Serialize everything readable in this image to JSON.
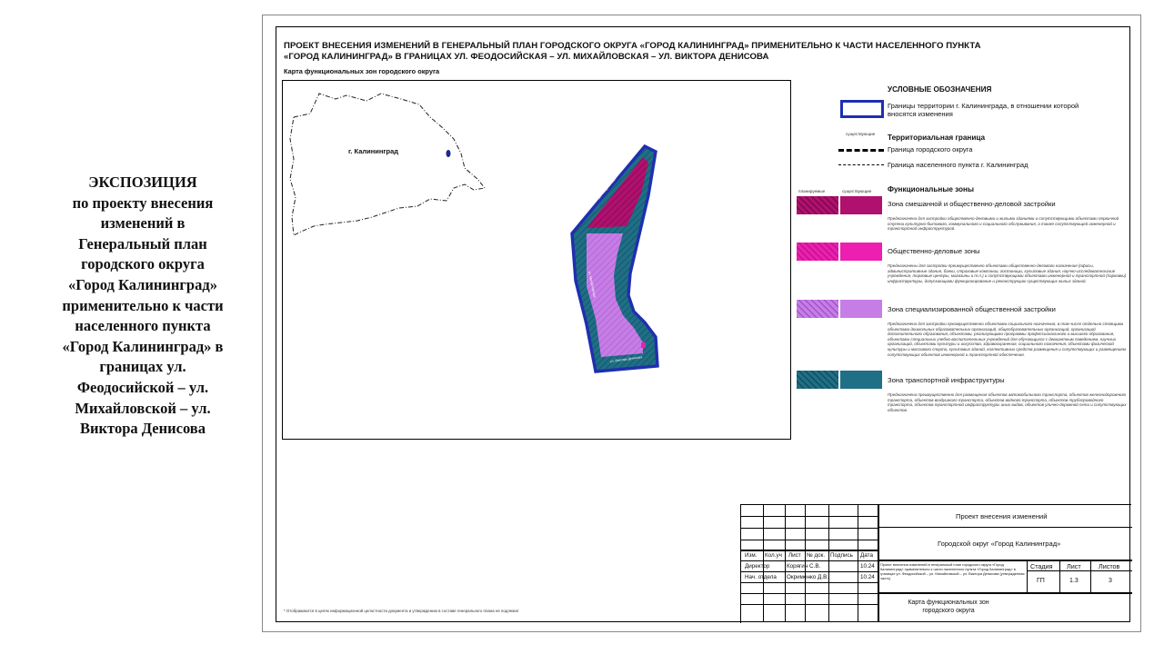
{
  "exposition": {
    "title": "ЭКСПОЗИЦИЯ",
    "body": "по проекту внесения изменений в Генеральный план городского округа «Город Калининград» применительно к части населенного пункта «Город Калининград» в границах ул. Феодосийской – ул. Михайловской – ул. Виктора Денисова"
  },
  "sheet": {
    "header_line1": "ПРОЕКТ ВНЕСЕНИЯ ИЗМЕНЕНИЙ В ГЕНЕРАЛЬНЫЙ ПЛАН ГОРОДСКОГО ОКРУГА «ГОРОД КАЛИНИНГРАД» ПРИМЕНИТЕЛЬНО К ЧАСТИ НАСЕЛЕННОГО ПУНКТА",
    "header_line2": "«ГОРОД КАЛИНИНГРАД» В ГРАНИЦАХ УЛ. ФЕОДОСИЙСКАЯ – УЛ. МИХАЙЛОВСКАЯ – УЛ. ВИКТОРА ДЕНИСОВА",
    "map_label": "Карта функциональных зон городского округа",
    "city_label": "г. Калининград",
    "footnote": "* Отображаются в целях информационной целостности документа и утверждению в составе генерального плана не подлежат"
  },
  "legend": {
    "title": "УСЛОВНЫЕ ОБОЗНАЧЕНИЯ",
    "boundary_text": "Границы территории г. Калининграда, в отношении которой вносятся изменения",
    "existing_label": "существующие",
    "planned_label": "планируемые",
    "territorial_title": "Территориальная граница",
    "district_border": "Граница городского округа",
    "settlement_border": "Граница населенного пункта г. Калининград",
    "zones_title": "Функциональные зоны",
    "zones": [
      {
        "name": "Зона смешанной и общественно-деловой застройки",
        "description": "Предназначена для застройки общественно-деловыми и жилыми зданиями и сопутствующими объектами первичной ступени культурно-бытового, коммунального и социального обслуживания, а также сопутствующей инженерной и транспортной инфраструктурой.",
        "color": "#b0106e"
      },
      {
        "name": "Общественно-деловые зоны",
        "description": "Предназначены для застройки преимущественно объектами общественно-делового назначения (офисы, административные здания, банки, страховые компании, гостиницы, культовые здания, научно-исследовательские учреждения, торговые центры, магазины и т.п.) и сопутствующими объектами инженерной и транспортной (парковки) инфраструктуры, допускающими функционирование и реконструкцию существующих жилых зданий.",
        "color": "#ec1fb0"
      },
      {
        "name": "Зона специализированной общественной застройки",
        "description": "Предназначена для застройки преимущественно объектами социального назначения, в том числе отдельно стоящими объектами дошкольных образовательных организаций, общеобразовательных организаций, организаций дополнительного образования, объектами, реализующими программы профессионального и высшего образования, объектами специальных учебно-воспитательных учреждений для обучающихся с девиантным поведением, научных организаций, объектами культуры и искусства, здравоохранения, социального назначения, объектами физической культуры и массового спорта, культовых зданий, коллективных средств размещения и сопутствующих и размещением сопутствующих объектов инженерной и транспортной обеспечения.",
        "color": "#c77de6"
      },
      {
        "name": "Зона транспортной инфраструктуры",
        "description": "Предназначена преимущественно для размещения объектов автомобильного транспорта, объектов железнодорожного транспорта, объектов воздушного транспорта, объектов водного транспорта, объектов трубопроводного транспорта, объектов транспортной инфраструктуры иных видов, объектов улично-дорожной сети и сопутствующих объектов.",
        "color": "#1f6f86"
      }
    ]
  },
  "title_block": {
    "columns": [
      "Изм.",
      "Кол.уч",
      "Лист",
      "№ док.",
      "Подпись",
      "Дата"
    ],
    "rows": [
      {
        "role": "Директор",
        "name": "Корягин С.В.",
        "date": "10.24"
      },
      {
        "role": "Нач. отдела",
        "name": "Окрименко Д.В.",
        "date": "10.24"
      }
    ],
    "project": "Проект внесения изменений",
    "district": "Городской округ «Город Калининград»",
    "doc_desc": "Проект внесения изменений в генеральный план городского округа «Город Калининград» применительно к части населенного пункта «Город Калининград» в границах ул. Феодосийской – ул. Михайловской – ул. Виктора Денисова (утвержденная часть)",
    "stage_label": "Стадия",
    "sheet_label": "Лист",
    "sheets_label": "Листов",
    "stage": "ГП",
    "sheet_no": "1.3",
    "sheets": "3",
    "map_name": "Карта функциональных зон городского округа"
  }
}
